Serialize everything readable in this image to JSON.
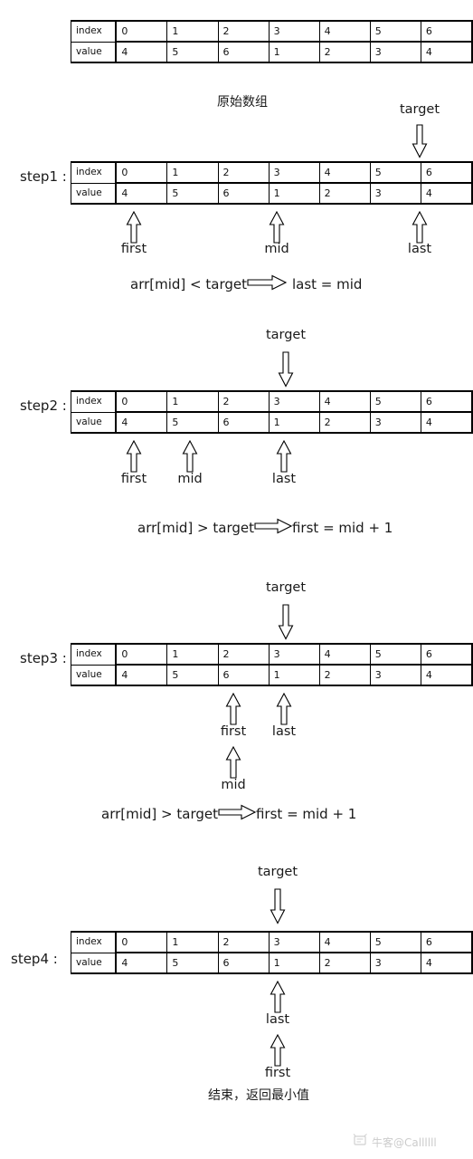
{
  "diagram": {
    "title_caption": "原始数组",
    "end_caption": "结束，返回最小值",
    "row_headers": {
      "index": "index",
      "value": "value"
    },
    "indices": [
      "0",
      "1",
      "2",
      "3",
      "4",
      "5",
      "6"
    ],
    "values": [
      "4",
      "5",
      "6",
      "1",
      "2",
      "3",
      "4"
    ],
    "pointer_names": {
      "first": "first",
      "mid": "mid",
      "last": "last",
      "target": "target"
    },
    "steps": [
      {
        "label": "step1 :",
        "formula_left": "arr[mid] < target",
        "formula_right": "last = mid",
        "target_index": 6,
        "pointers": [
          {
            "name": "first",
            "index": 0
          },
          {
            "name": "mid",
            "index": 3
          },
          {
            "name": "last",
            "index": 6
          }
        ]
      },
      {
        "label": "step2 :",
        "formula_left": "arr[mid] > target",
        "formula_right": "first = mid + 1",
        "target_index": 3,
        "pointers": [
          {
            "name": "first",
            "index": 0
          },
          {
            "name": "mid",
            "index": 1
          },
          {
            "name": "last",
            "index": 3
          }
        ]
      },
      {
        "label": "step3 :",
        "formula_left": "arr[mid] > target",
        "formula_right": "first = mid + 1",
        "target_index": 3,
        "pointers": [
          {
            "name": "first",
            "index": 2
          },
          {
            "name": "last",
            "index": 3
          },
          {
            "name": "mid",
            "index": 2
          }
        ]
      },
      {
        "label": "step4 :",
        "formula_left": "",
        "formula_right": "",
        "target_index": 3,
        "pointers": [
          {
            "name": "last",
            "index": 3
          },
          {
            "name": "first",
            "index": 3
          }
        ]
      }
    ]
  },
  "watermark": {
    "text": "牛客@Callllll"
  }
}
